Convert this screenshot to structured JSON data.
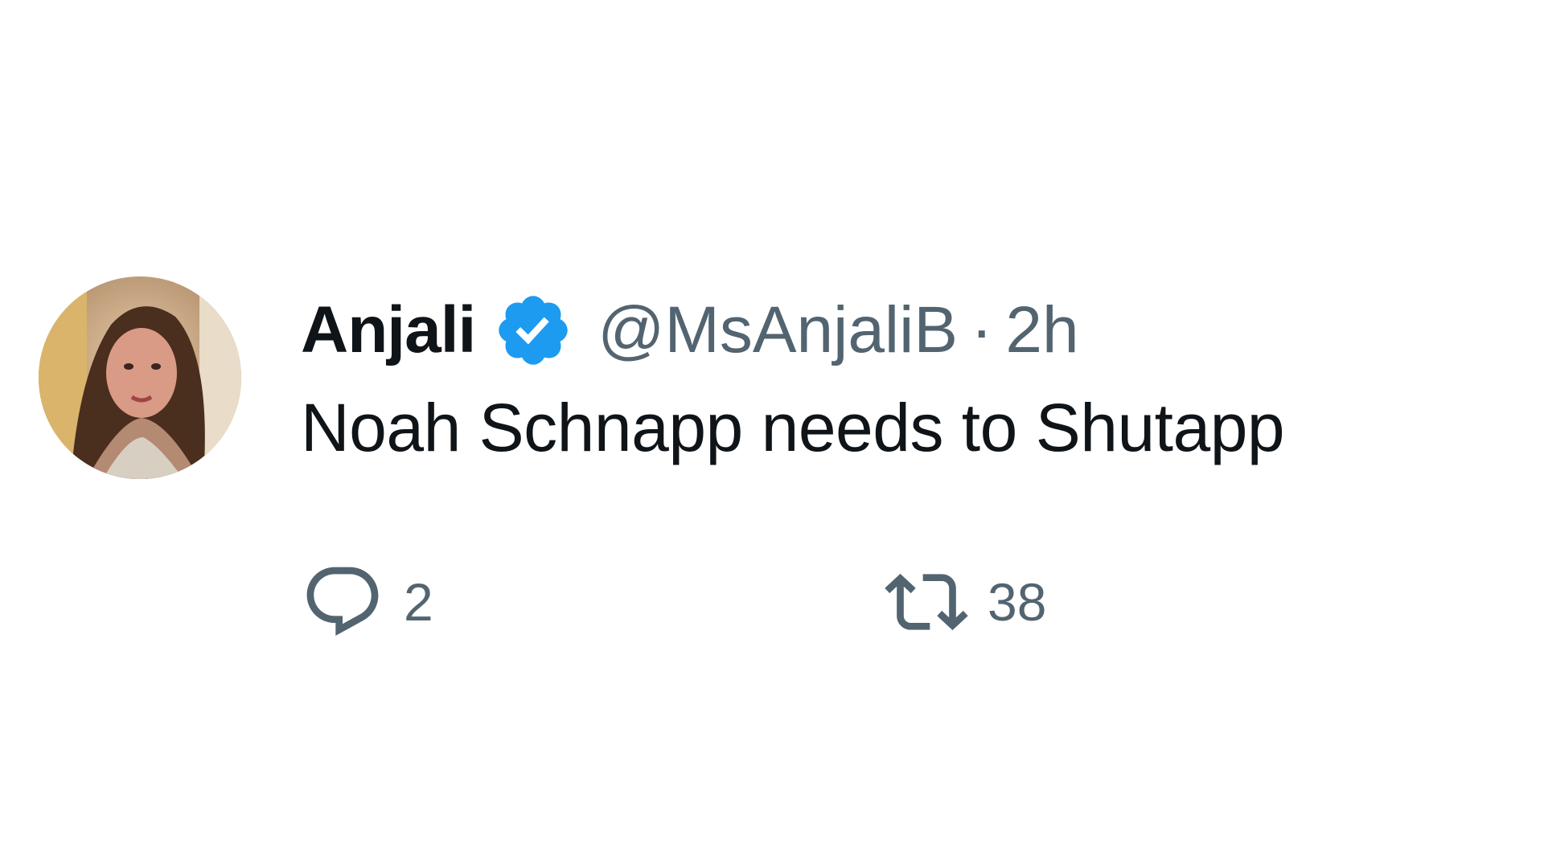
{
  "tweet": {
    "display_name": "Anjali",
    "handle": "@MsAnjaliB",
    "separator": "·",
    "time": "2h",
    "text": "Noah Schnapp needs to Shutapp",
    "verified_icon": "verified-badge-icon",
    "verified_color": "#1d9bf0",
    "text_color": "#0f1419",
    "muted_color": "#536471"
  },
  "actions": {
    "reply": {
      "icon": "reply-icon",
      "count": "2"
    },
    "retweet": {
      "icon": "retweet-icon",
      "count": "38"
    }
  }
}
